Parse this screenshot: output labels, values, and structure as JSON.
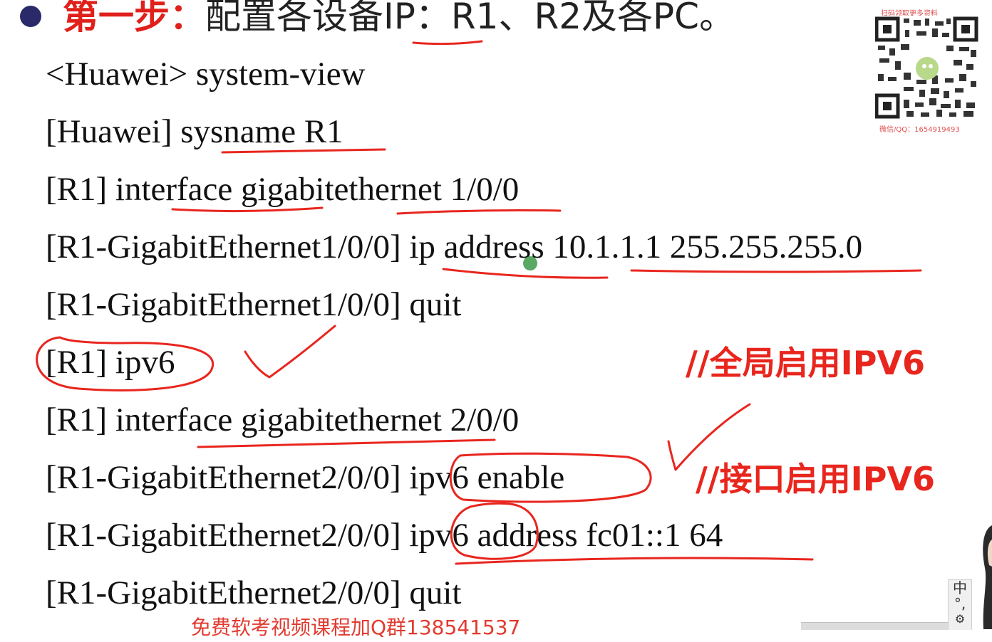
{
  "slide": {
    "title_step": "第一步：",
    "title_rest": "配置各设备IP：R1、R2及各PC。",
    "lines": [
      "<Huawei> system-view",
      "[Huawei] sysname R1",
      "[R1] interface gigabitethernet 1/0/0",
      "[R1-GigabitEthernet1/0/0] ip address 10.1.1.1 255.255.255.0",
      "[R1-GigabitEthernet1/0/0] quit",
      "[R1] ipv6",
      "[R1] interface gigabitethernet 2/0/0",
      "[R1-GigabitEthernet2/0/0] ipv6 enable",
      "[R1-GigabitEthernet2/0/0] ipv6 address fc01::1 64",
      "[R1-GigabitEthernet2/0/0] quit"
    ],
    "comment_global": "//全局启用IPV6",
    "comment_interface": "//接口启用IPV6",
    "promo": "免费软考视频课程加Q群138541537"
  },
  "qr": {
    "top_text": "扫码领取更多资料",
    "bottom_text": "微信/QQ：1654919493"
  },
  "ime": {
    "mode": "中",
    "symbol": "°,",
    "tool": "⚙"
  },
  "colors": {
    "title_step": "#e0201b",
    "annotation_red": "#e8261e",
    "bullet": "#2a2a6a"
  }
}
